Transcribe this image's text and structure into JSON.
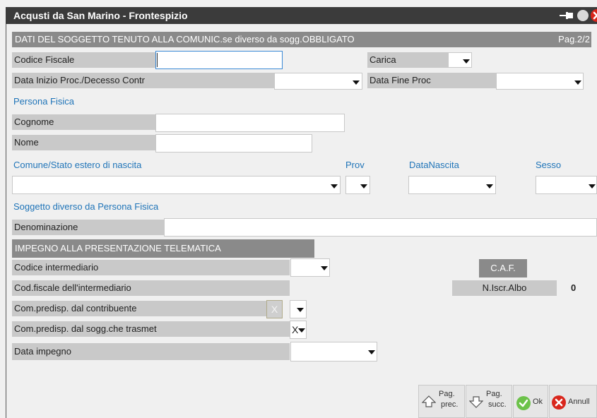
{
  "window": {
    "title": "Acqusti da San Marino - Frontespizio"
  },
  "header": {
    "title": "DATI DEL SOGGETTO TENUTO ALLA COMUNIC.se diverso da sogg.OBBLIGATO",
    "page": "Pag.2/2"
  },
  "fields": {
    "codice_fiscale": {
      "label": "Codice Fiscale",
      "value": ""
    },
    "carica": {
      "label": "Carica",
      "value": ""
    },
    "data_inizio": {
      "label": "Data Inizio Proc./Decesso Contr",
      "value": ""
    },
    "data_fine": {
      "label": "Data Fine Proc",
      "value": ""
    }
  },
  "persona_fisica": {
    "section": "Persona Fisica",
    "cognome": {
      "label": "Cognome",
      "value": ""
    },
    "nome": {
      "label": "Nome",
      "value": ""
    },
    "comune_label": "Comune/Stato estero di nascita",
    "prov_label": "Prov",
    "data_nascita_label": "DataNascita",
    "sesso_label": "Sesso"
  },
  "soggetto_diverso": {
    "section": "Soggetto diverso da Persona Fisica",
    "denominazione": {
      "label": "Denominazione",
      "value": ""
    }
  },
  "impegno": {
    "header": "IMPEGNO ALLA PRESENTAZIONE TELEMATICA",
    "codice_intermediario": {
      "label": "Codice intermediario",
      "value": ""
    },
    "cf_intermediario": {
      "label": "Cod.fiscale dell'intermediario",
      "value": ""
    },
    "com_contribuente": {
      "label": "Com.predisp. dal contribuente",
      "value": "X"
    },
    "com_sogg": {
      "label": "Com.predisp. dal sogg.che trasmet",
      "value": "X"
    },
    "data_impegno": {
      "label": "Data impegno",
      "value": ""
    },
    "caf_label": "C.A.F.",
    "n_iscr_label": "N.Iscr.Albo",
    "n_iscr_value": "0"
  },
  "footer": {
    "prev": {
      "line1": "Pag.",
      "line2": "prec."
    },
    "next": {
      "line1": "Pag.",
      "line2": "succ."
    },
    "ok": "Ok",
    "cancel": "Annull"
  },
  "colors": {
    "titlebar": "#3b3b3b",
    "header": "#8a8a8a",
    "label_bg": "#c9c9c9",
    "section_text": "#1f74b8",
    "ok_green": "#6cc24a",
    "cancel_red": "#d9261c"
  }
}
